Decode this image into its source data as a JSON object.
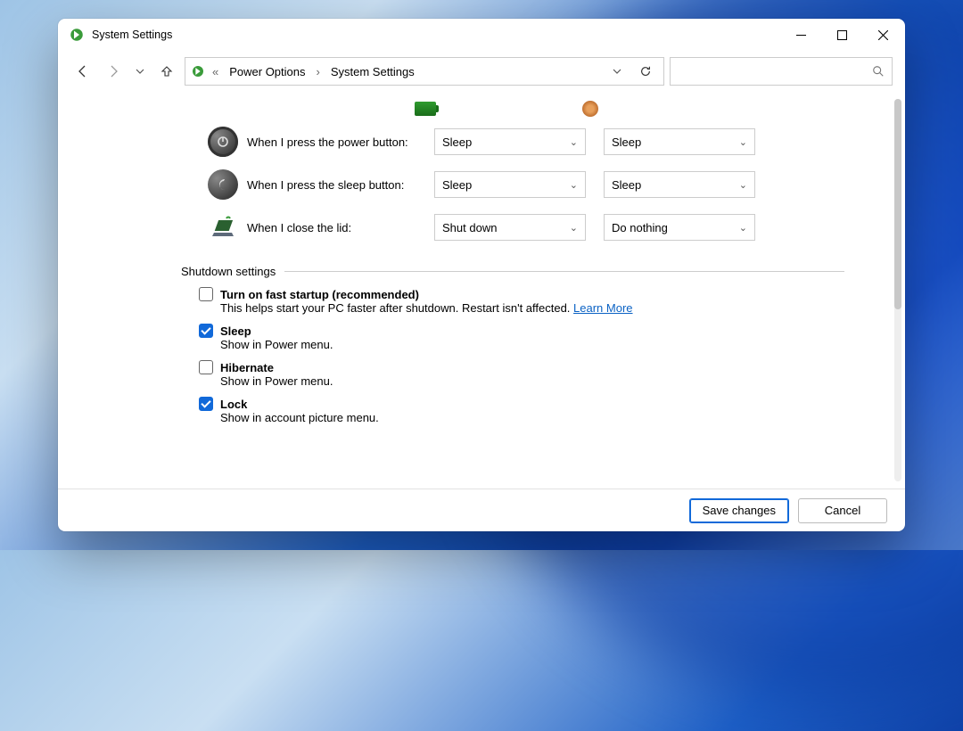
{
  "window": {
    "title": "System Settings"
  },
  "address": {
    "prefix": "«",
    "crumb1": "Power Options",
    "crumb2": "System Settings"
  },
  "settings": {
    "power_button": {
      "label": "When I press the power button:",
      "battery": "Sleep",
      "plugged": "Sleep"
    },
    "sleep_button": {
      "label": "When I press the sleep button:",
      "battery": "Sleep",
      "plugged": "Sleep"
    },
    "close_lid": {
      "label": "When I close the lid:",
      "battery": "Shut down",
      "plugged": "Do nothing"
    }
  },
  "shutdown": {
    "header": "Shutdown settings",
    "fast": {
      "title": "Turn on fast startup (recommended)",
      "sub": "This helps start your PC faster after shutdown. Restart isn't affected. ",
      "link": "Learn More"
    },
    "sleep": {
      "title": "Sleep",
      "sub": "Show in Power menu."
    },
    "hibernate": {
      "title": "Hibernate",
      "sub": "Show in Power menu."
    },
    "lock": {
      "title": "Lock",
      "sub": "Show in account picture menu."
    }
  },
  "footer": {
    "save": "Save changes",
    "cancel": "Cancel"
  }
}
